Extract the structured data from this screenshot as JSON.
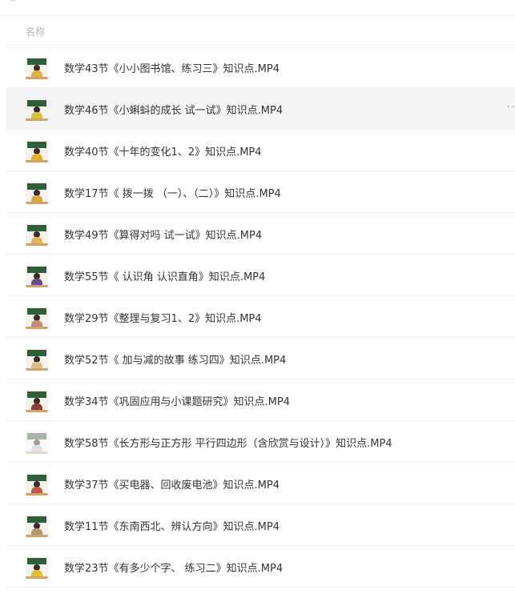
{
  "header": {
    "name_column": "名称"
  },
  "files": [
    {
      "name": "数学43节《小小图书馆、练习三》知识点.MP4",
      "color": "#e0b040"
    },
    {
      "name": "数学46节《小蝌蚪的成长 试一试》知识点.MP4",
      "color": "#d7c23a"
    },
    {
      "name": "数学40节《十年的变化1、2》知识点.MP4",
      "color": "#e3b12c"
    },
    {
      "name": "数学17节《 拨一拨 （一）、（二）》知识点.MP4",
      "color": "#d9a93c"
    },
    {
      "name": "数学49节《算得对吗 试一试》知识点.MP4",
      "color": "#e0b85a"
    },
    {
      "name": "数学55节《 认识角 认识直角》知识点.MP4",
      "color": "#6a4b8a"
    },
    {
      "name": "数学29节《整理与复习1、2》知识点.MP4",
      "color": "#c98a7a"
    },
    {
      "name": "数学52节《 加与减的故事 练习四》知识点.MP4",
      "color": "#d8c08a"
    },
    {
      "name": "数学34节《巩固应用与小课题研究》知识点.MP4",
      "color": "#8a3a3a"
    },
    {
      "name": "数学58节《长方形与正方形 平行四边形（含欣赏与设计）》知识点.MP4",
      "color": "#bcbcbc"
    },
    {
      "name": "数学37节《买电器、回收废电池》知识点.MP4",
      "color": "#c05a4a"
    },
    {
      "name": "数学11节《东南西北、辨认方向》知识点.MP4",
      "color": "#b09a6a"
    },
    {
      "name": "数学23节《有多少个字、 练习二》知识点.MP4",
      "color": "#e3c030"
    }
  ],
  "row_more_label": "··",
  "colors": {
    "hover_row": "#f5f5f5",
    "text": "#333333",
    "header_text": "#b5b5b5"
  }
}
